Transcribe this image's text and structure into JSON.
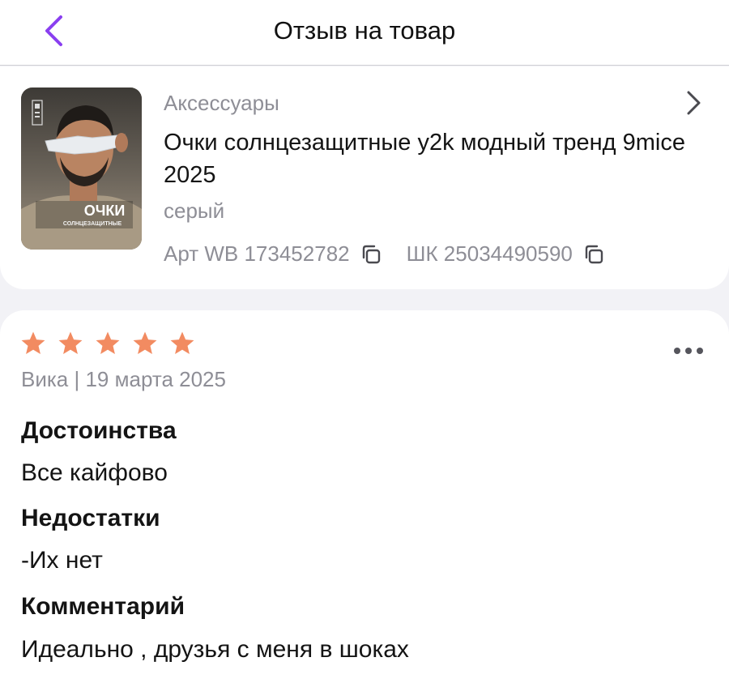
{
  "header": {
    "title": "Отзыв на товар"
  },
  "product": {
    "category": "Аксессуары",
    "title": "Очки солнцезащитные y2k модный тренд 9mice 2025",
    "color": "серый",
    "article_label": "Арт WB 173452782",
    "barcode_label": "ШК 25034490590",
    "thumbnail": {
      "caption_main": "ОЧКИ",
      "caption_sub": "СОЛНЦЕЗАЩИТНЫЕ"
    }
  },
  "review": {
    "rating": 5,
    "rating_max": 5,
    "meta": "Вика | 19 марта 2025",
    "pros_heading": "Достоинства",
    "pros_text": "Все кайфово",
    "cons_heading": "Недостатки",
    "cons_text": "-Их нет",
    "comment_heading": "Комментарий",
    "comment_text": "Идеально , друзья с меня в шоках"
  },
  "colors": {
    "accent_purple": "#8a3ff0",
    "star_orange": "#f28b61",
    "muted_text": "#8e8e96",
    "background": "#f2f2f6"
  },
  "icons": {
    "back": "chevron-left-icon",
    "open_product": "chevron-right-icon",
    "copy": "copy-icon",
    "more": "more-dots-icon",
    "star": "star-icon"
  }
}
